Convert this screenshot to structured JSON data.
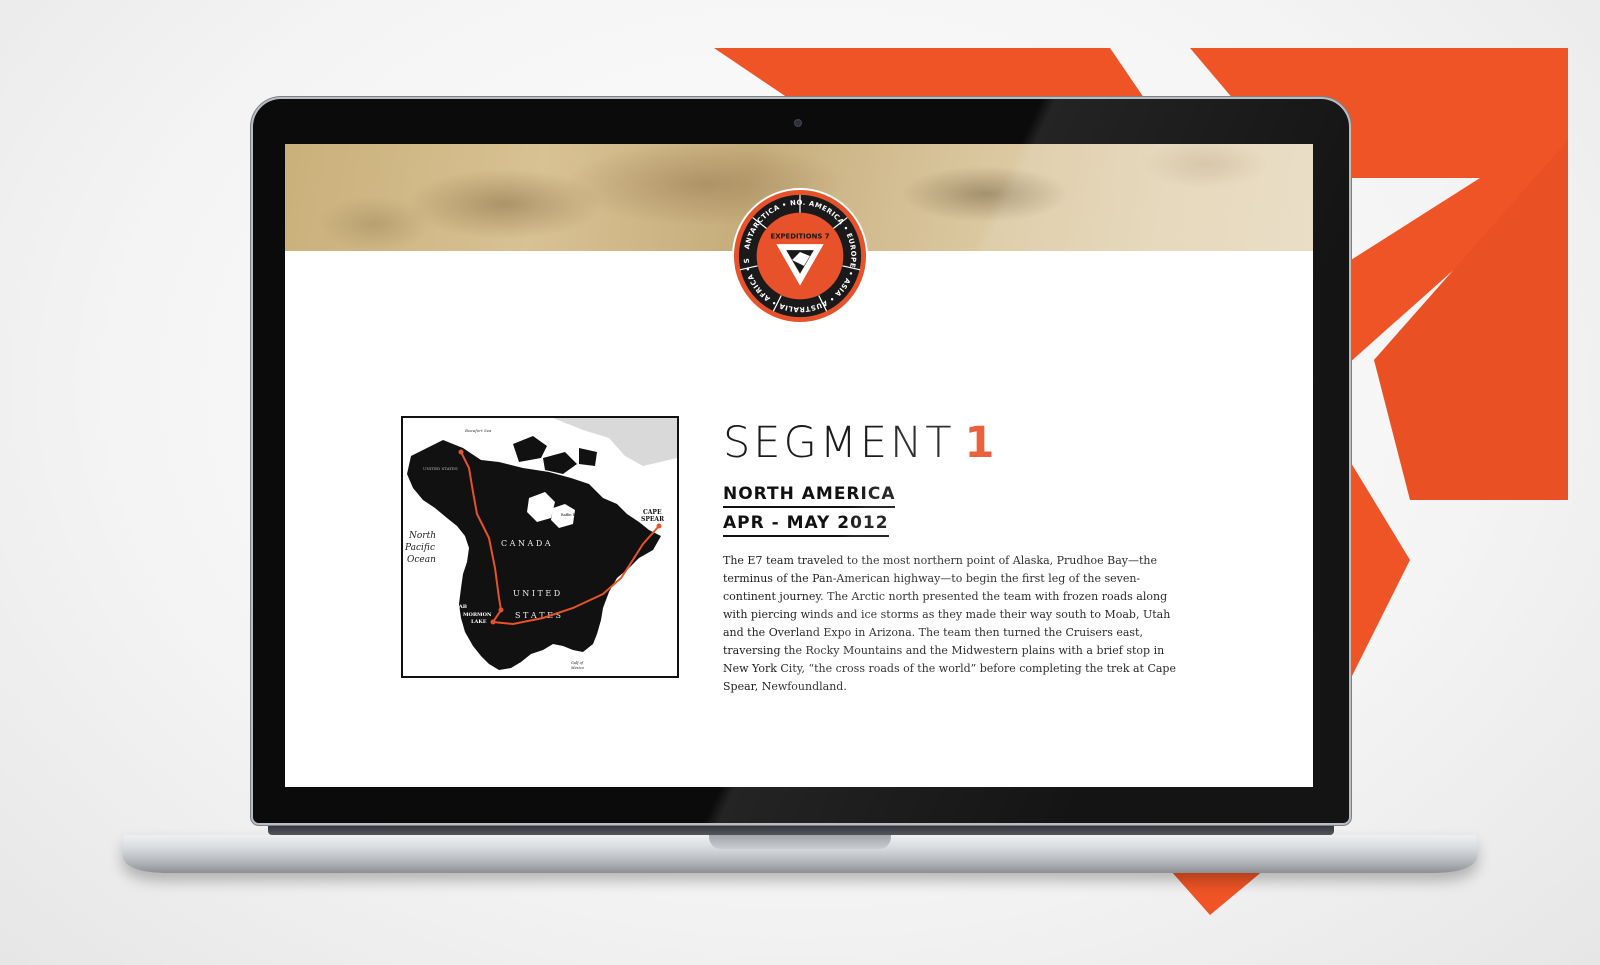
{
  "badge": {
    "brand": "EXPEDITIONS 7",
    "continents": [
      "NO. AMERICA",
      "EUROPE",
      "ASIA",
      "AUSTRALIA",
      "AFRICA",
      "SO. AMERICA",
      "ANTARCTICA"
    ]
  },
  "segment": {
    "title_word": "SEGMENT",
    "title_number": "1",
    "region": "NORTH AMERICA",
    "dates": "APR - MAY 2012",
    "description": "The E7 team traveled to the most northern point of Alaska, Prudhoe Bay—the terminus of the Pan-American highway—to begin the first leg of the seven-continent journey. The Arctic north presented the team with frozen roads along with piercing winds and ice storms as they made their way south to Moab, Utah and the Overland Expo in Arizona. The team then turned the Cruisers east, traversing the Rocky Mountains and the Midwestern plains with a brief stop in New York City, “the cross roads of the world” before completing the trek at Cape Spear, Newfoundland."
  },
  "map": {
    "beaufort_sea": "Beaufort Sea",
    "alaska": "UNITED STATES",
    "ocean_line1": "North",
    "ocean_line2": "Pacific",
    "ocean_line3": "Ocean",
    "canada": "C A N A D A",
    "baffin_bay": "Baffin Bay",
    "cape_spear_line1": "CAPE",
    "cape_spear_line2": "SPEAR",
    "us_line1": "U N I T E D",
    "us_line2": "S T A T E S",
    "moab": "MOAB",
    "mormon_lake_line1": "MORMON",
    "mormon_lake_line2": "LAKE",
    "gulf_line1": "Gulf of",
    "gulf_line2": "Mexico"
  },
  "colors": {
    "accent": "#e8522a",
    "text": "#1b1b1b",
    "frame": "#0b0b0b"
  }
}
